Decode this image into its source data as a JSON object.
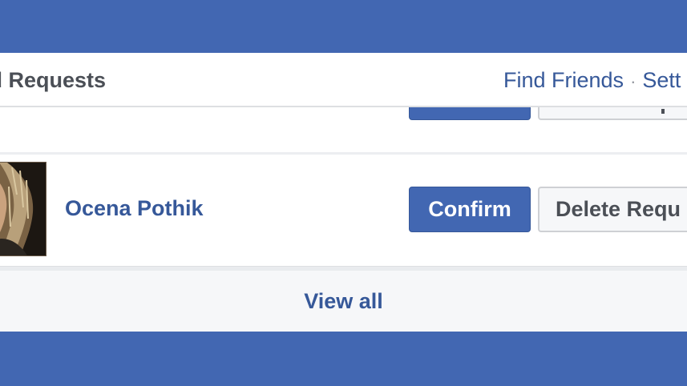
{
  "header": {
    "title": "nd Requests",
    "find_friends": "Find Friends",
    "separator": "·",
    "settings": "Sett"
  },
  "request": {
    "name": "Ocena Pothik",
    "confirm_label": "Confirm",
    "delete_label": "Delete Requ"
  },
  "footer": {
    "view_all": "View all"
  },
  "colors": {
    "brand_blue": "#4267b2",
    "link_blue": "#365899",
    "text_gray": "#4b4f56",
    "panel_white": "#ffffff",
    "button_gray": "#f6f7f9"
  }
}
